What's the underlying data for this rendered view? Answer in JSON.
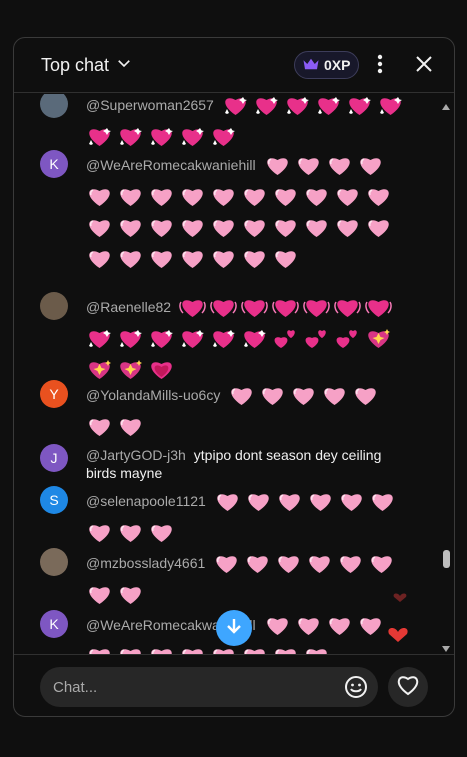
{
  "header": {
    "title": "Top chat",
    "xp_label": "0XP"
  },
  "messages": [
    {
      "author": "@Superwoman2657",
      "avatar_letter": "",
      "avatar_color": "#5a6a7a",
      "emojis": [
        "sparkling-heart",
        "sparkling-heart",
        "sparkling-heart",
        "sparkling-heart",
        "sparkling-heart",
        "sparkling-heart",
        "sparkling-heart",
        "sparkling-heart",
        "sparkling-heart",
        "sparkling-heart",
        "sparkling-heart"
      ],
      "text": ""
    },
    {
      "author": "@WeAreRomecakwaniehill",
      "avatar_letter": "K",
      "avatar_color": "#7e57c2",
      "emojis_count": 31,
      "text": ""
    },
    {
      "author": "@Raenelle82",
      "avatar_letter": "",
      "avatar_color": "#6b5b4a",
      "emojis": [
        "beating-heart",
        "beating-heart",
        "beating-heart",
        "beating-heart",
        "beating-heart",
        "beating-heart",
        "beating-heart",
        "sparkling-heart",
        "sparkling-heart",
        "sparkling-heart",
        "sparkling-heart",
        "sparkling-heart",
        "sparkling-heart",
        "two-hearts",
        "two-hearts",
        "two-hearts",
        "heart-with-sparkles",
        "heart-with-sparkles",
        "heart-with-sparkles",
        "growing-heart",
        "growing-heart",
        "growing-heart",
        "growing-heart",
        "growing-heart",
        "growing-heart"
      ],
      "text": ""
    },
    {
      "author": "@YolandaMills-uo6cy",
      "avatar_letter": "Y",
      "avatar_color": "#e9511f",
      "emojis_count": 7,
      "text": ""
    },
    {
      "author": "@JartyGOD-j3h",
      "avatar_letter": "J",
      "avatar_color": "#7e57c2",
      "text": "ytpipo dont season dey ceiling birds mayne"
    },
    {
      "author": "@selenapoole1121",
      "avatar_letter": "S",
      "avatar_color": "#1e88e5",
      "emojis_count": 9,
      "text": ""
    },
    {
      "author": "@mzbosslady4661",
      "avatar_letter": "",
      "avatar_color": "#7a6a5a",
      "emojis_count": 8,
      "text": ""
    },
    {
      "author": "@WeAreRomecakwaniehill",
      "avatar_letter": "K",
      "avatar_color": "#7e57c2",
      "emojis_count": 12,
      "text": ""
    }
  ],
  "footer": {
    "input_placeholder": "Chat..."
  },
  "colors": {
    "accent": "#3ea6ff",
    "heart_pink": "#f6a1c6",
    "xp_purple": "#8b5cf6"
  }
}
